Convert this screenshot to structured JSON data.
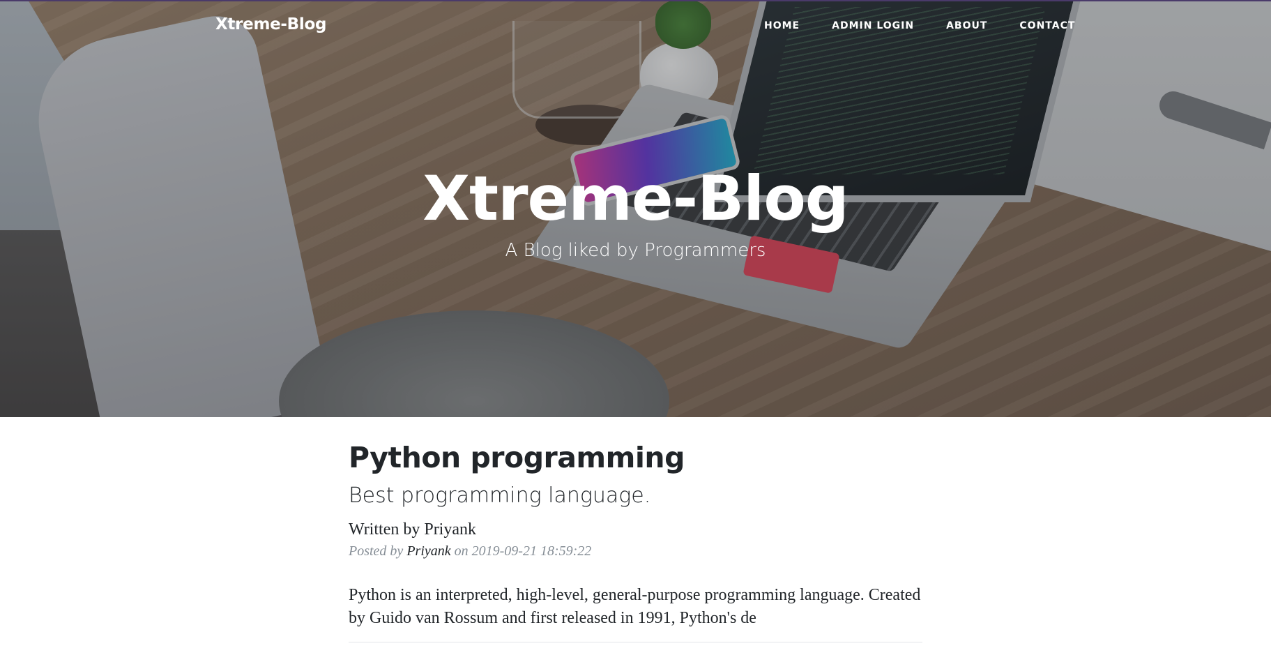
{
  "navbar": {
    "brand": "Xtreme-Blog",
    "links": [
      {
        "label": "HOME"
      },
      {
        "label": "ADMIN LOGIN"
      },
      {
        "label": "ABOUT"
      },
      {
        "label": "CONTACT"
      }
    ]
  },
  "hero": {
    "title": "Xtreme-Blog",
    "subtitle": "A Blog liked by Programmers"
  },
  "post": {
    "title": "Python programming",
    "subtitle": "Best programming language.",
    "author_line": "Written by Priyank",
    "meta_prefix": "Posted by",
    "meta_author": "Priyank",
    "meta_on": "on",
    "meta_date": "2019-09-21 18:59:22",
    "excerpt": "Python is an interpreted, high-level, general-purpose programming language. Created by Guido van Rossum and first released in 1991, Python's de"
  },
  "colors": {
    "text_dark": "#212529",
    "text_muted": "#868e96",
    "overlay": "#212529",
    "divider": "#e3e5e8"
  }
}
